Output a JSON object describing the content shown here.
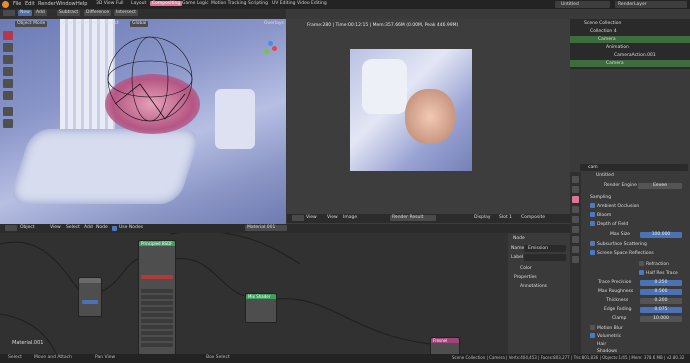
{
  "menu": [
    "File",
    "Edit",
    "Render",
    "Window",
    "Help"
  ],
  "workspaces": [
    "3D View Full",
    "Layout",
    "Compositing",
    "Game Logic",
    "Motion Tracking",
    "Scripting",
    "UV Editing",
    "Video Editing"
  ],
  "active_workspace": "Compositing",
  "scene_name": "Untitled",
  "render_layer": "RenderLayer",
  "editor_tabs": [
    "New",
    "Add",
    "Subtract",
    "Difference",
    "Intersect"
  ],
  "viewport": {
    "mode": "Object Mode",
    "menus": [
      "View",
      "Select",
      "Add",
      "Object"
    ],
    "orientation": "Global",
    "overlays": "Overlays"
  },
  "image_editor": {
    "info": "Frame:280 | Time:00:12:15 | Mem:357.66M (0.00M, Peak 446.99M)",
    "menus": [
      "View",
      "View",
      "Image"
    ],
    "image_name": "Render Result",
    "display": "Display",
    "slot": "Slot 1",
    "composite": "Composite"
  },
  "outliner": {
    "header": "Scene Collection",
    "rows": [
      "Collection 4",
      "Camera",
      "Animation",
      "CameraAction.001",
      "Camera"
    ]
  },
  "properties": {
    "search": "cam",
    "scene": "Untitled",
    "render_engine_label": "Render Engine",
    "render_engine": "Eevee",
    "sampling": "Sampling",
    "ambient_occlusion": "Ambient Occlusion",
    "bloom": "Bloom",
    "depth_of_field": "Depth of Field",
    "max_size_label": "Max Size",
    "max_size": "100.000",
    "subsurface": "Subsurface Scattering",
    "ssr": "Screen Space Reflections",
    "refraction": "Refraction",
    "half_res": "Half Res Trace",
    "trace_precision_label": "Trace Precision",
    "trace_precision": "0.250",
    "max_roughness_label": "Max Roughness",
    "max_roughness": "0.500",
    "thickness_label": "Thickness",
    "thickness": "0.200",
    "edge_fading_label": "Edge Fading",
    "edge_fading": "0.075",
    "clamp_label": "Clamp",
    "clamp": "10.000",
    "motion_blur": "Motion Blur",
    "volumetric": "Volumetric",
    "hair": "Hair",
    "shadows": "Shadows"
  },
  "node_editor": {
    "type": "Object",
    "menus": [
      "View",
      "Select",
      "Add",
      "Node"
    ],
    "use_nodes": "Use Nodes",
    "material": "Material.001",
    "material_label": "Material.001",
    "sidebar_title": "Node",
    "name_label": "Name",
    "name_value": "Emission",
    "label_label": "Label",
    "color_label": "Color",
    "properties_label": "Properties",
    "annotations_label": "Annotations",
    "nodes": [
      "Principled BSDF",
      "Mix Shader",
      "Fresnel"
    ]
  },
  "status": {
    "left": [
      "Select",
      "Move and Attach",
      "Pan View",
      "Box Select"
    ],
    "right": "Scene Collection | Camera | Verts:404,453 | Faces:803,277 | Tris:801,836 | Objects:1/45 | Mem: 378.6 MB | v2.80.32"
  }
}
